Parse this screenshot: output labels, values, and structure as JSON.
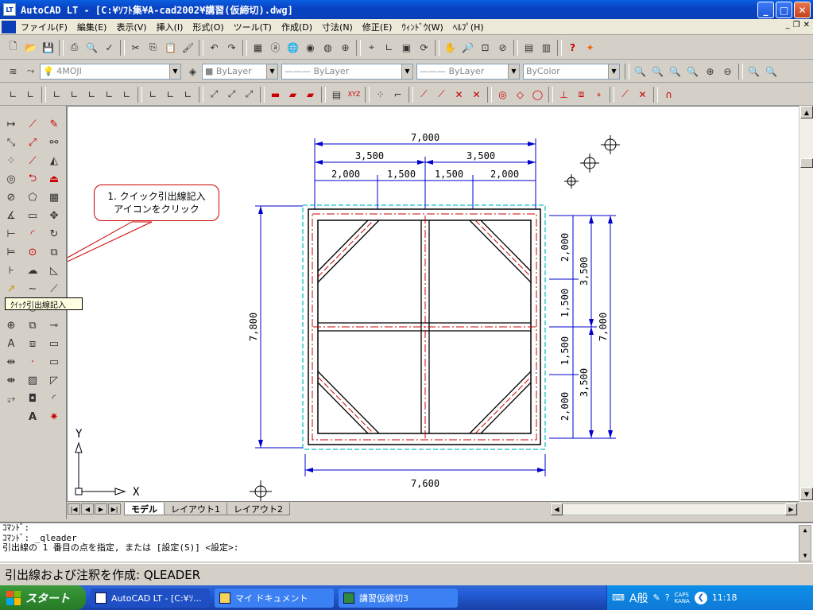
{
  "window": {
    "title": "AutoCAD LT - [C:¥ｿﾌﾄ集¥A-cad2002¥講習(仮締切).dwg]",
    "app_icon": "LT"
  },
  "menu": [
    "ファイル(F)",
    "編集(E)",
    "表示(V)",
    "挿入(I)",
    "形式(O)",
    "ツール(T)",
    "作成(D)",
    "寸法(N)",
    "修正(E)",
    "ｳｨﾝﾄﾞｳ(W)",
    "ﾍﾙﾌﾟ(H)"
  ],
  "layer_toolbar": {
    "layer_name": "4MOJI",
    "color": "ByLayer",
    "linetype": "ByLayer",
    "lineweight": "ByLayer",
    "plotstyle": "ByColor"
  },
  "tooltip": "ｸｲｯｸ引出線記入",
  "callout": {
    "line1": "1. クイック引出線記入",
    "line2": "アイコンをクリック"
  },
  "drawing": {
    "top_overall": "7,000",
    "top_half_left": "3,500",
    "top_half_right": "3,500",
    "top_seg": [
      "2,000",
      "1,500",
      "1,500",
      "2,000"
    ],
    "left_overall": "7,800",
    "bottom_overall": "7,600",
    "right_seg": [
      "2,000",
      "1,500",
      "1,500",
      "2,000"
    ],
    "right_half_top": "3,500",
    "right_half_bottom": "3,500",
    "right_overall": "7,000",
    "ucs_x": "X",
    "ucs_y": "Y"
  },
  "tabs": [
    "モデル",
    "レイアウト1",
    "レイアウト2"
  ],
  "command_lines": [
    "ｺﾏﾝﾄﾞ:",
    "ｺﾏﾝﾄﾞ: _qleader",
    "引出線の 1 番目の点を指定, または [設定(S)] <設定>:"
  ],
  "status_text": "引出線および注釈を作成:  QLEADER",
  "taskbar": {
    "start": "スタート",
    "tasks": [
      "AutoCAD LT - [C:¥ｿ...",
      "マイ ドキュメント",
      "講習仮締切3"
    ],
    "ime": "A般",
    "caps": "CAPS",
    "kana": "KANA",
    "clock": "11:18"
  }
}
